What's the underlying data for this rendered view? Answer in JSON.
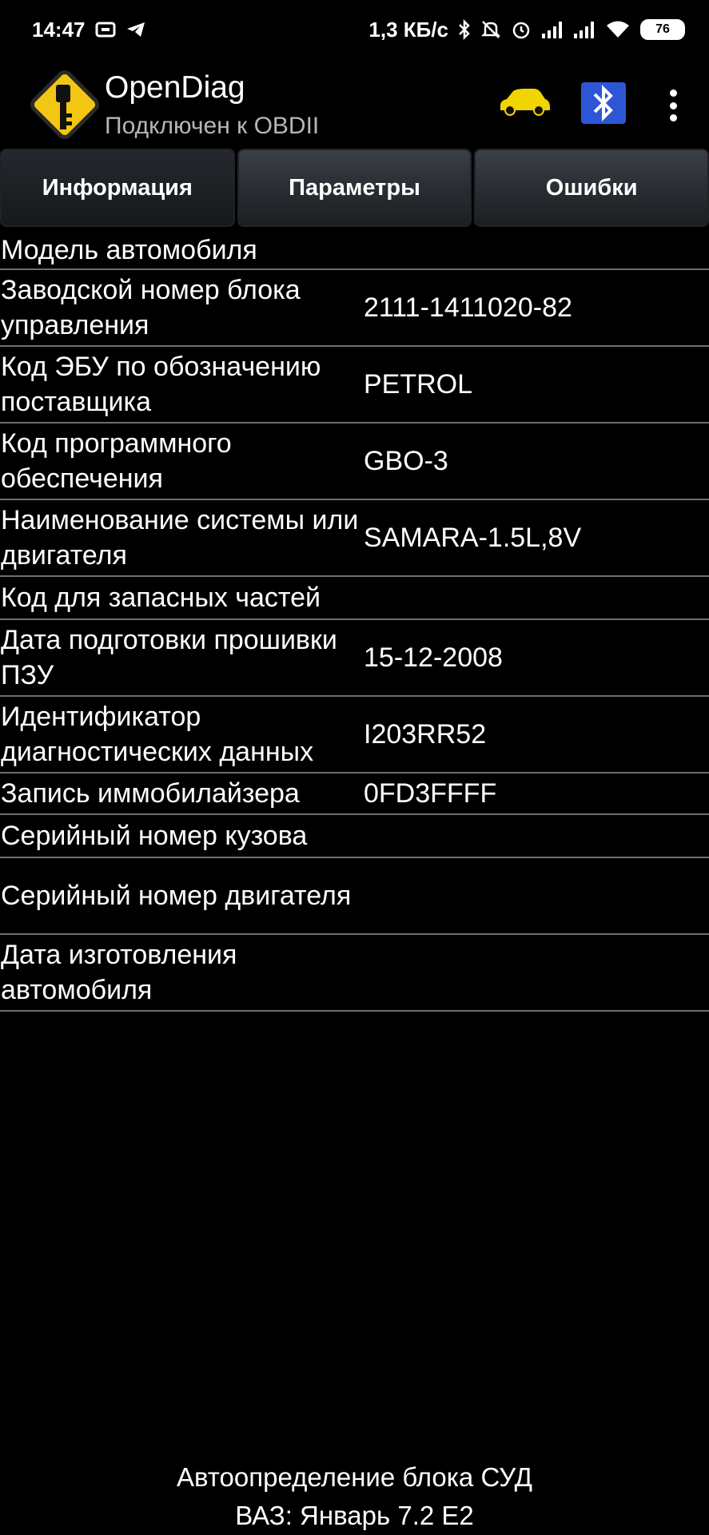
{
  "status_bar": {
    "time": "14:47",
    "net_speed": "1,3 КБ/с",
    "battery": "76"
  },
  "app_bar": {
    "title": "OpenDiag",
    "subtitle": "Подключен к OBDII"
  },
  "tabs": [
    {
      "label": "Информация",
      "active": true
    },
    {
      "label": "Параметры",
      "active": false
    },
    {
      "label": "Ошибки",
      "active": false
    }
  ],
  "info": [
    {
      "label": "Модель автомобиля",
      "value": ""
    },
    {
      "label": "Заводской номер блока управления",
      "value": "2111-1411020-82"
    },
    {
      "label": "Код ЭБУ по обозначению поставщика",
      "value": "PETROL"
    },
    {
      "label": "Код программного обеспечения",
      "value": "GBO-3"
    },
    {
      "label": "Наименование системы или двигателя",
      "value": "SAMARA-1.5L,8V"
    },
    {
      "label": "Код для запасных частей",
      "value": ""
    },
    {
      "label": "Дата подготовки прошивки ПЗУ",
      "value": "15-12-2008"
    },
    {
      "label": "Идентификатор диагностических данных",
      "value": "I203RR52"
    },
    {
      "label": "Запись иммобилайзера",
      "value": "0FD3FFFF"
    },
    {
      "label": "Серийный номер кузова",
      "value": ""
    },
    {
      "label": "Серийный номер двигателя",
      "value": ""
    },
    {
      "label": "Дата изготовления автомобиля",
      "value": ""
    }
  ],
  "footer": {
    "line1": "Автоопределение блока СУД",
    "line2": "ВАЗ: Январь 7.2 E2"
  },
  "colors": {
    "background": "#000000",
    "logo_yellow": "#f3c613",
    "car_yellow": "#f2d400",
    "bluetooth_blue": "#2d56d6",
    "divider": "#6e6e6e"
  }
}
